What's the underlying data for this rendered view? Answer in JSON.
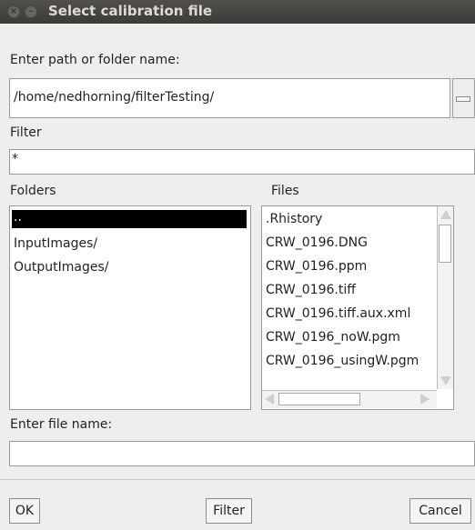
{
  "window": {
    "title": "Select calibration file"
  },
  "path": {
    "label": "Enter path or folder name:",
    "value": "/home/nedhorning/filterTesting/"
  },
  "filter": {
    "label": "Filter",
    "value": "*"
  },
  "folders": {
    "label": "Folders",
    "items": [
      {
        "name": "..",
        "selected": true
      },
      {
        "name": "InputImages/"
      },
      {
        "name": "OutputImages/"
      }
    ]
  },
  "files": {
    "label": "Files",
    "items": [
      ".Rhistory",
      "CRW_0196.DNG",
      "CRW_0196.ppm",
      "CRW_0196.tiff",
      "CRW_0196.tiff.aux.xml",
      "CRW_0196_noW.pgm",
      "CRW_0196_usingW.pgm"
    ]
  },
  "filename": {
    "label": "Enter file name:",
    "value": ""
  },
  "buttons": {
    "ok": "OK",
    "filter": "Filter",
    "cancel": "Cancel"
  },
  "icons": {
    "close": "close-icon",
    "minimize": "minimize-icon",
    "browse": "browse-icon"
  },
  "colors": {
    "titlebar": "#3c3b37",
    "selection": "#000000",
    "background": "#eeeeee"
  }
}
